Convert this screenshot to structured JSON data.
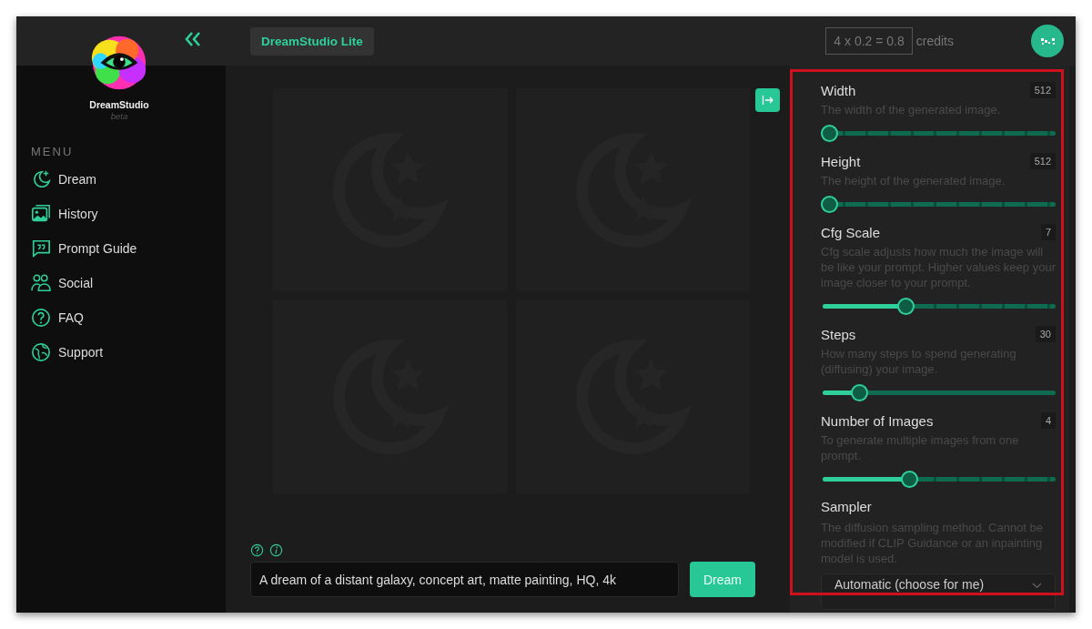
{
  "sidebar": {
    "brand": "DreamStudio",
    "brand_tag": "beta",
    "menu_label": "MENU",
    "items": [
      {
        "label": "Dream"
      },
      {
        "label": "History"
      },
      {
        "label": "Prompt Guide"
      },
      {
        "label": "Social"
      },
      {
        "label": "FAQ"
      },
      {
        "label": "Support"
      }
    ]
  },
  "top_bar": {
    "title_button": "DreamStudio Lite",
    "credits_formula": "4 x 0.2 = 0.8",
    "credits_label": "credits"
  },
  "image_grid": {
    "tiles": [
      {
        "kind": "placeholder"
      },
      {
        "kind": "placeholder"
      },
      {
        "kind": "placeholder"
      },
      {
        "kind": "placeholder"
      }
    ]
  },
  "prompt": {
    "value": "A dream of a distant galaxy, concept art, matte painting, HQ, 4k",
    "button": "Dream"
  },
  "settings": [
    {
      "label": "Width",
      "value": "512",
      "description": "The width of the generated image.",
      "kind": "stepped",
      "level": 0
    },
    {
      "label": "Height",
      "value": "512",
      "description": "The height of the generated image.",
      "kind": "stepped",
      "level": 0
    },
    {
      "label": "Cfg Scale",
      "value": "7",
      "description": "Cfg scale adjusts how much the image will be like your prompt. Higher values keep your image closer to your prompt.",
      "kind": "stepped",
      "level": 0.35
    },
    {
      "label": "Steps",
      "value": "30",
      "description": "How many steps to spend generating (diffusing) your image.",
      "kind": "continuous",
      "level": 0.14
    },
    {
      "label": "Number of Images",
      "value": "4",
      "description": "To generate multiple images from one prompt.",
      "kind": "stepped",
      "level": 0.37
    }
  ],
  "sampler": {
    "label": "Sampler",
    "description": "The diffusion sampling method. Cannot be modified if CLIP Guidance or an inpainting model is used.",
    "value": "Automatic (choose for me)"
  }
}
